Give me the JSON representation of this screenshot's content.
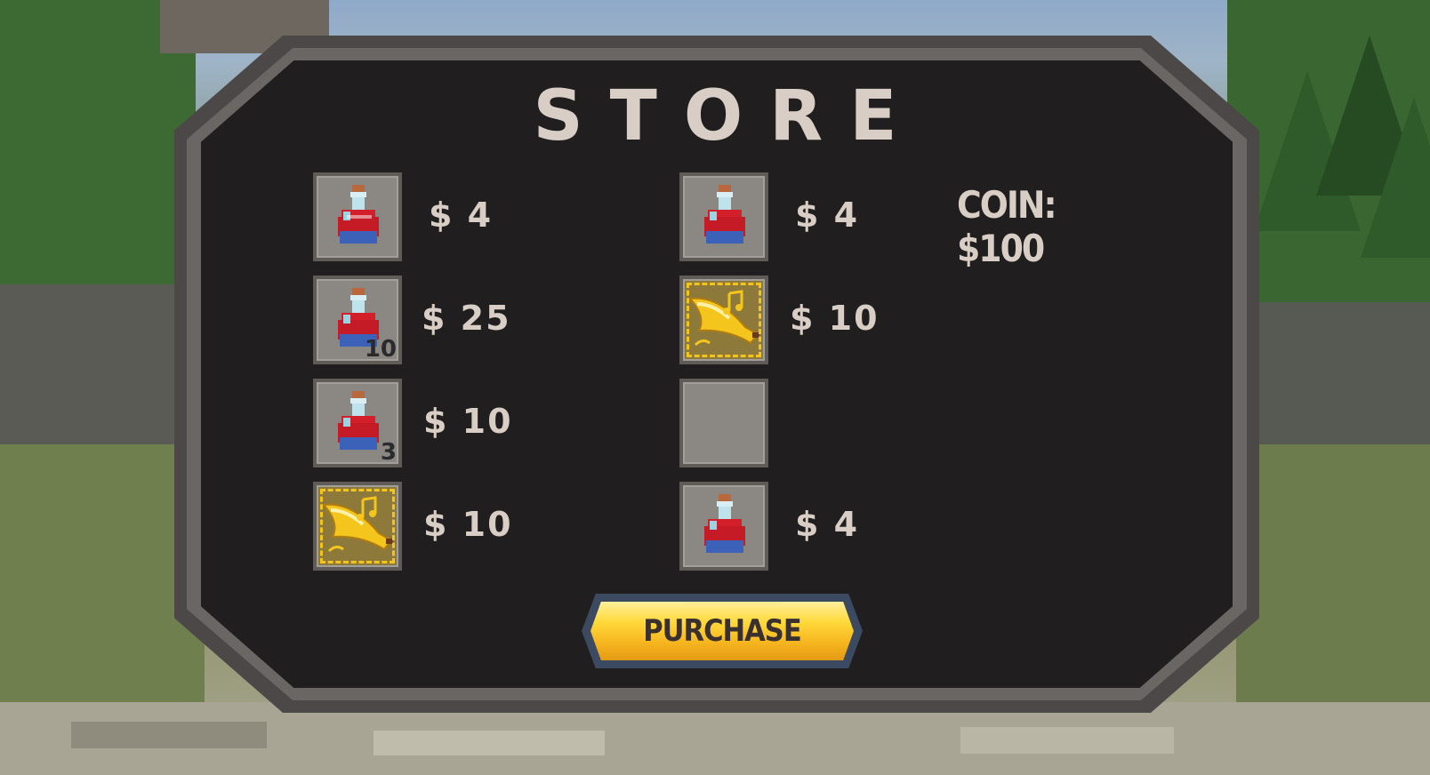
{
  "store": {
    "title": "STORE",
    "coin_label": "COIN: $100"
  },
  "left_column": [
    {
      "icon": "red-potion-icon",
      "price": "$ 4",
      "quantity": ""
    },
    {
      "icon": "red-potion-icon",
      "price": "$ 25",
      "quantity": "10"
    },
    {
      "icon": "red-potion-icon",
      "price": "$ 10",
      "quantity": "3"
    },
    {
      "icon": "golden-horn-icon",
      "price": "$ 10",
      "quantity": ""
    }
  ],
  "right_column": [
    {
      "icon": "red-potion-icon",
      "price": "$ 4",
      "quantity": ""
    },
    {
      "icon": "golden-horn-icon",
      "price": "$ 10",
      "quantity": ""
    },
    {
      "icon": "",
      "price": "",
      "quantity": ""
    },
    {
      "icon": "red-potion-icon",
      "price": "$ 4",
      "quantity": ""
    }
  ],
  "purchase": {
    "label": "PURCHASE"
  },
  "colors": {
    "panel": "#201e1e",
    "frame": "#4b4847",
    "text": "#d8cec6",
    "button_gold": "#ffd93b",
    "button_border": "#3c4a61",
    "slot": "#8b8783"
  }
}
